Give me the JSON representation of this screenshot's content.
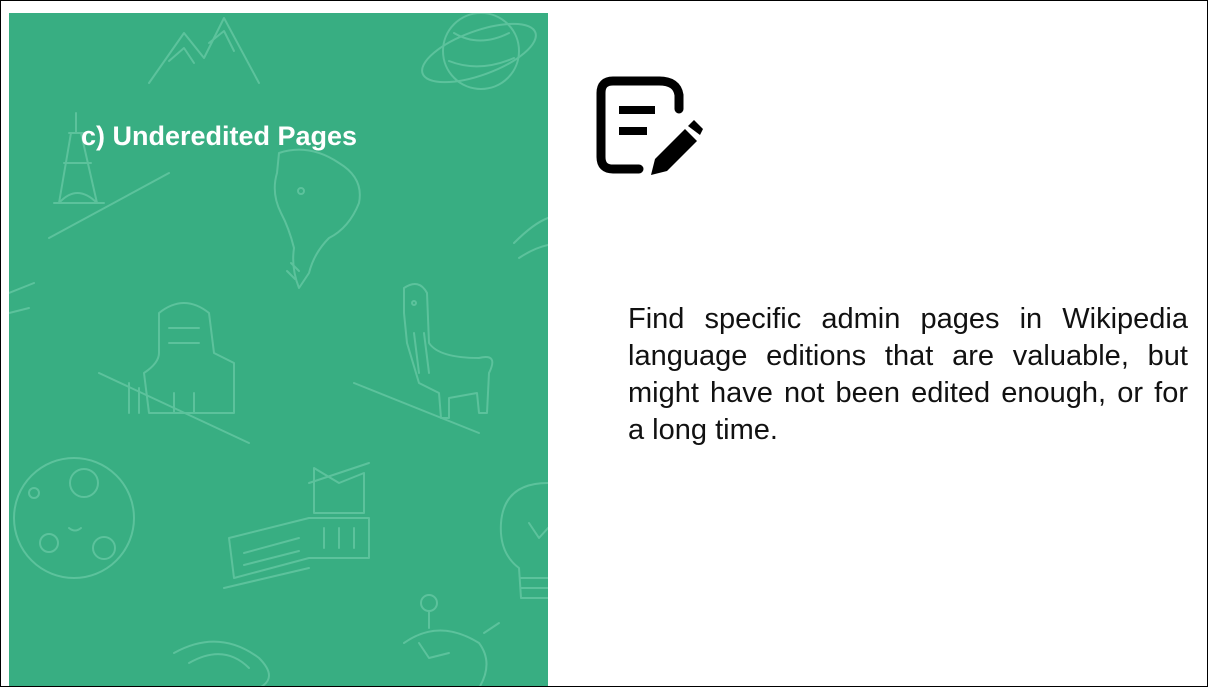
{
  "slide": {
    "title": "c) Underedited Pages",
    "body": "Find specific admin pages in Wikipedia language editions that are valuable, but might have not been edited enough, or for a long time."
  },
  "icons": {
    "main": "edit-document-icon",
    "background": [
      "mountain-icon",
      "saturn-planet-icon",
      "eiffel-tower-icon",
      "south-america-map-icon",
      "sphinx-icon",
      "llama-icon",
      "moon-icon",
      "great-wall-icon",
      "lightbulb-icon",
      "boomerang-icon",
      "clock-icon"
    ]
  },
  "colors": {
    "panel": "#38ae82",
    "panel_lines": "#5cc29c",
    "title": "#ffffff",
    "text": "#111111",
    "icon": "#000000"
  }
}
